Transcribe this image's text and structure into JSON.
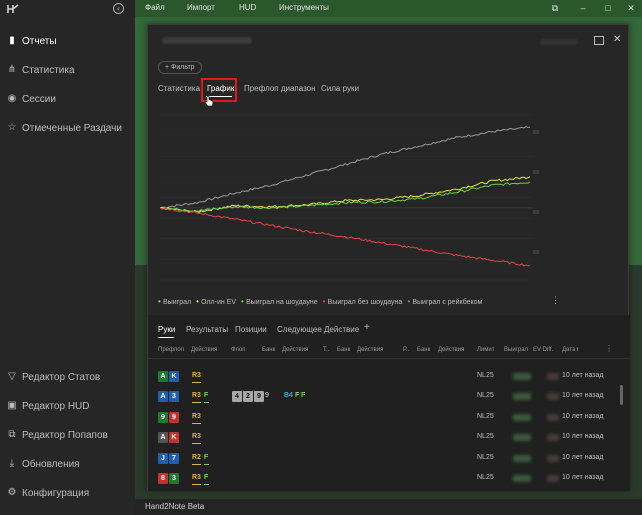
{
  "menu": {
    "file": "Файл",
    "import": "Импорт",
    "hud": "HUD",
    "tools": "Инструменты"
  },
  "sidebar": {
    "items": [
      {
        "label": "Отчеты",
        "icon": "book-icon",
        "active": true
      },
      {
        "label": "Статистика",
        "icon": "graph-nodes-icon"
      },
      {
        "label": "Сессии",
        "icon": "broadcast-icon"
      },
      {
        "label": "Отмеченные Раздачи",
        "icon": "star-icon"
      }
    ],
    "bottom_items": [
      {
        "label": "Редактор Статов",
        "icon": "filter-icon"
      },
      {
        "label": "Редактор HUD",
        "icon": "hud-icon"
      },
      {
        "label": "Редактор Попапов",
        "icon": "popup-icon"
      },
      {
        "label": "Обновления",
        "icon": "download-icon"
      },
      {
        "label": "Конфигурация",
        "icon": "gear-icon"
      }
    ]
  },
  "filter_button": "+ Фильтр",
  "tabs": [
    "Статистика",
    "График",
    "Префлоп диапазон",
    "Сила руки"
  ],
  "active_tab": "График",
  "chart_data": {
    "type": "line",
    "series": [
      {
        "name": "Выиграл",
        "color": "#9a9a9a",
        "values": [
          0,
          5,
          14,
          22,
          32,
          42,
          52,
          60,
          68,
          74,
          78
        ]
      },
      {
        "name": "Олл-ин EV",
        "color": "#e8e24a",
        "values": [
          0,
          -4,
          2,
          1,
          3,
          7,
          8,
          12,
          18,
          26,
          30
        ]
      },
      {
        "name": "Выиграл на шоудауне",
        "color": "#69d64a",
        "values": [
          0,
          -3,
          1,
          0,
          2,
          5,
          6,
          9,
          15,
          22,
          25
        ]
      },
      {
        "name": "Выиграл без шоудауна",
        "color": "#e04545",
        "values": [
          0,
          -5,
          -11,
          -17,
          -23,
          -28,
          -34,
          -40,
          -46,
          -51,
          -56
        ]
      },
      {
        "name": "Выиграл с рейкбеком",
        "color": "#4a9fe0",
        "values": []
      }
    ],
    "grid": true,
    "legend": "bottom"
  },
  "legend": [
    {
      "label": "Выиграл",
      "color": "#b9b9b9"
    },
    {
      "label": "Олл-ин EV",
      "color": "#e8e24a"
    },
    {
      "label": "Выиграл на шоудауне",
      "color": "#69d64a"
    },
    {
      "label": "Выиграл без шоудауна",
      "color": "#e04545"
    },
    {
      "label": "Выиграл с рейкбеком",
      "color": "#4a9fe0"
    }
  ],
  "hands_tabs": [
    "Руки",
    "Результаты",
    "Позиции",
    "Следующее Действие"
  ],
  "add_tab": "+",
  "columns": [
    "Префлоп",
    "Действия",
    "Флоп",
    "Банк",
    "Действия",
    "Т..",
    "Банк",
    "Действия",
    "Р..",
    "Банк",
    "Действия",
    "Лимит",
    "Выиграл",
    "EV Diff.",
    "Дата"
  ],
  "sort_indicator": "↑",
  "rows": [
    {
      "cards": [
        {
          "r": "A",
          "c": "#1e7a2e"
        },
        {
          "r": "K",
          "c": "#1e5fb3"
        }
      ],
      "preflop": "R3",
      "preflop_f": "",
      "flop": [],
      "flop_action": [],
      "limit": "NL25",
      "date": "10 лет назад"
    },
    {
      "cards": [
        {
          "r": "A",
          "c": "#1e5fb3"
        },
        {
          "r": "3",
          "c": "#1e5fb3"
        }
      ],
      "preflop": "R3",
      "preflop_f": "F",
      "flop": [
        "4",
        "2",
        "9"
      ],
      "flop_extra": "9",
      "flop_action": [
        "B4",
        "F",
        "F"
      ],
      "limit": "NL25",
      "date": "10 лет назад"
    },
    {
      "cards": [
        {
          "r": "9",
          "c": "#1e7a2e"
        },
        {
          "r": "9",
          "c": "#c7302d"
        }
      ],
      "preflop": "R3",
      "preflop_f": "",
      "flop": [],
      "flop_action": [],
      "limit": "NL25",
      "date": "10 лет назад"
    },
    {
      "cards": [
        {
          "r": "A",
          "c": "#555555"
        },
        {
          "r": "K",
          "c": "#c7302d"
        }
      ],
      "preflop": "R3",
      "preflop_f": "",
      "flop": [],
      "flop_action": [],
      "limit": "NL25",
      "date": "10 лет назад"
    },
    {
      "cards": [
        {
          "r": "J",
          "c": "#1e5fb3"
        },
        {
          "r": "7",
          "c": "#1e5fb3"
        }
      ],
      "preflop": "R2",
      "preflop_f": "F",
      "flop": [],
      "flop_action": [],
      "limit": "NL25",
      "date": "10 лет назад"
    },
    {
      "cards": [
        {
          "r": "8",
          "c": "#c7302d"
        },
        {
          "r": "3",
          "c": "#1e7a2e"
        }
      ],
      "preflop": "R3",
      "preflop_f": "F",
      "flop": [],
      "flop_action": [],
      "limit": "NL25",
      "date": "10 лет назад"
    }
  ],
  "status": "Hand2Note Beta"
}
